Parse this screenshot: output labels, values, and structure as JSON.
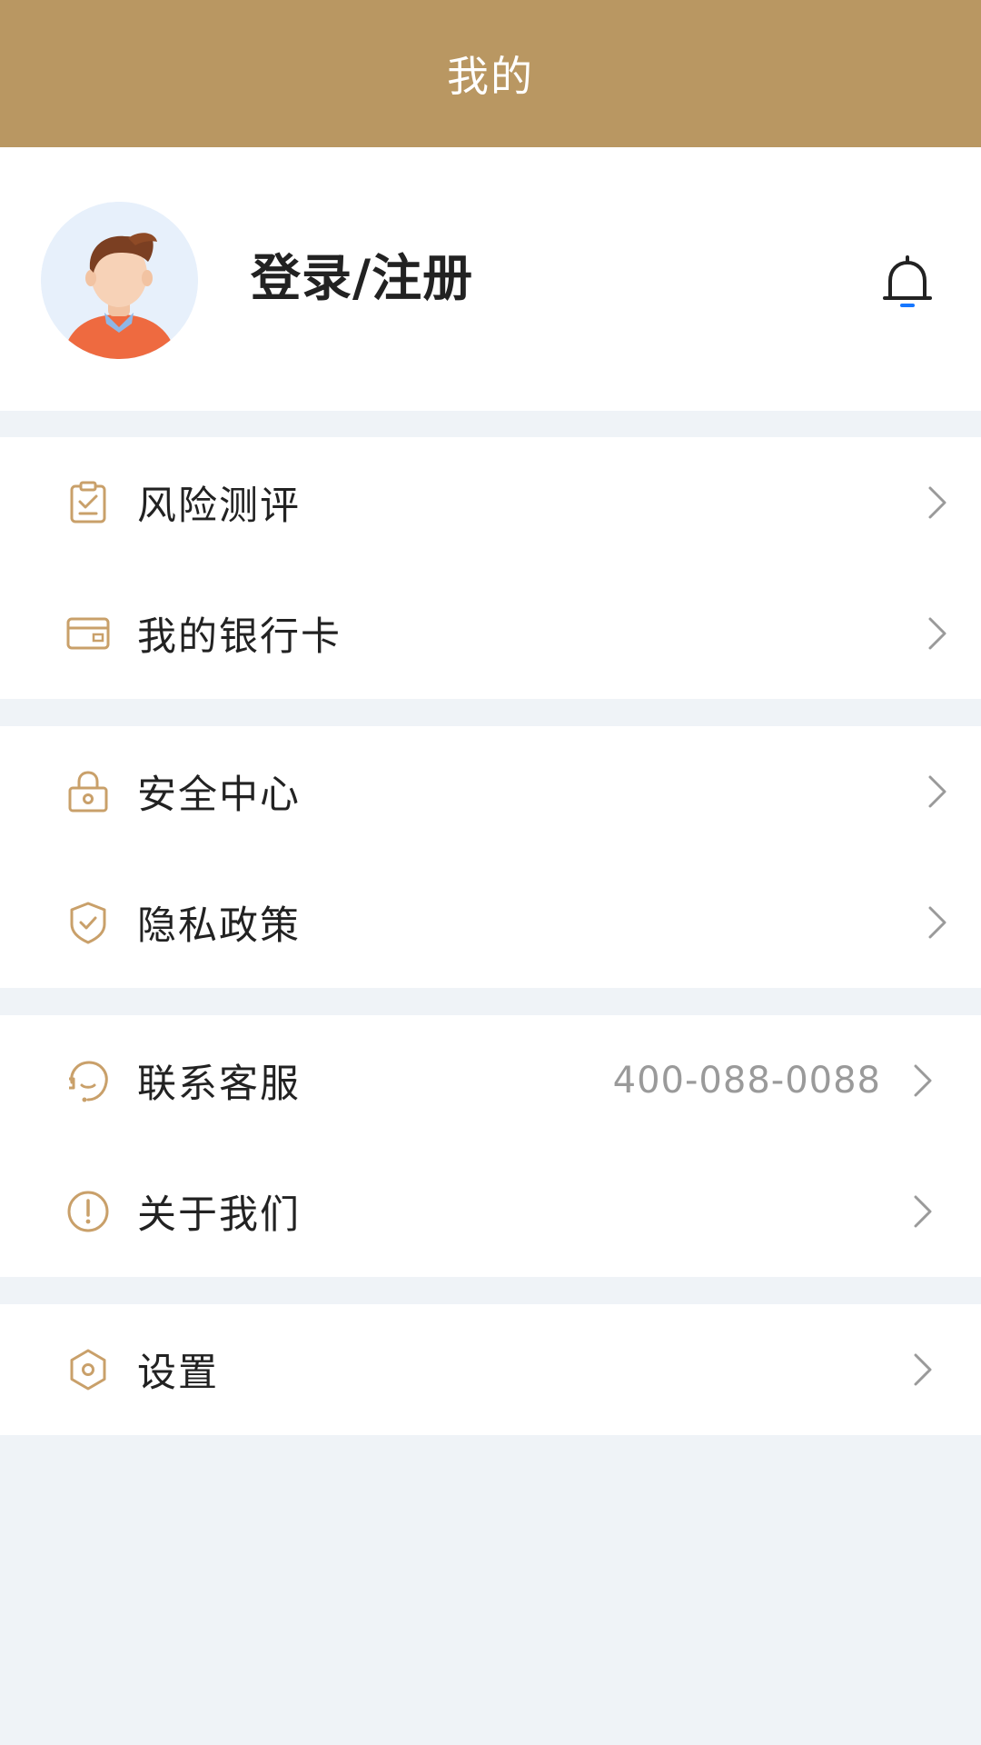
{
  "header": {
    "title": "我的"
  },
  "profile": {
    "login_label": "登录/注册",
    "avatar_icon": "user-avatar-icon",
    "bell_icon": "bell-icon"
  },
  "colors": {
    "header_bg": "#b99762",
    "accent": "#c9a06a",
    "page_bg": "#eff3f7",
    "text": "#222222",
    "muted": "#9a9a9a",
    "bell_dot": "#1677ff"
  },
  "menu": {
    "risk": {
      "label": "风险测评",
      "icon": "clipboard-check-icon"
    },
    "bank_card": {
      "label": "我的银行卡",
      "icon": "card-icon"
    },
    "security": {
      "label": "安全中心",
      "icon": "lock-icon"
    },
    "privacy": {
      "label": "隐私政策",
      "icon": "shield-check-icon"
    },
    "service": {
      "label": "联系客服",
      "value": "400-088-0088",
      "icon": "headset-icon"
    },
    "about": {
      "label": "关于我们",
      "icon": "info-icon"
    },
    "settings": {
      "label": "设置",
      "icon": "hex-gear-icon"
    }
  }
}
